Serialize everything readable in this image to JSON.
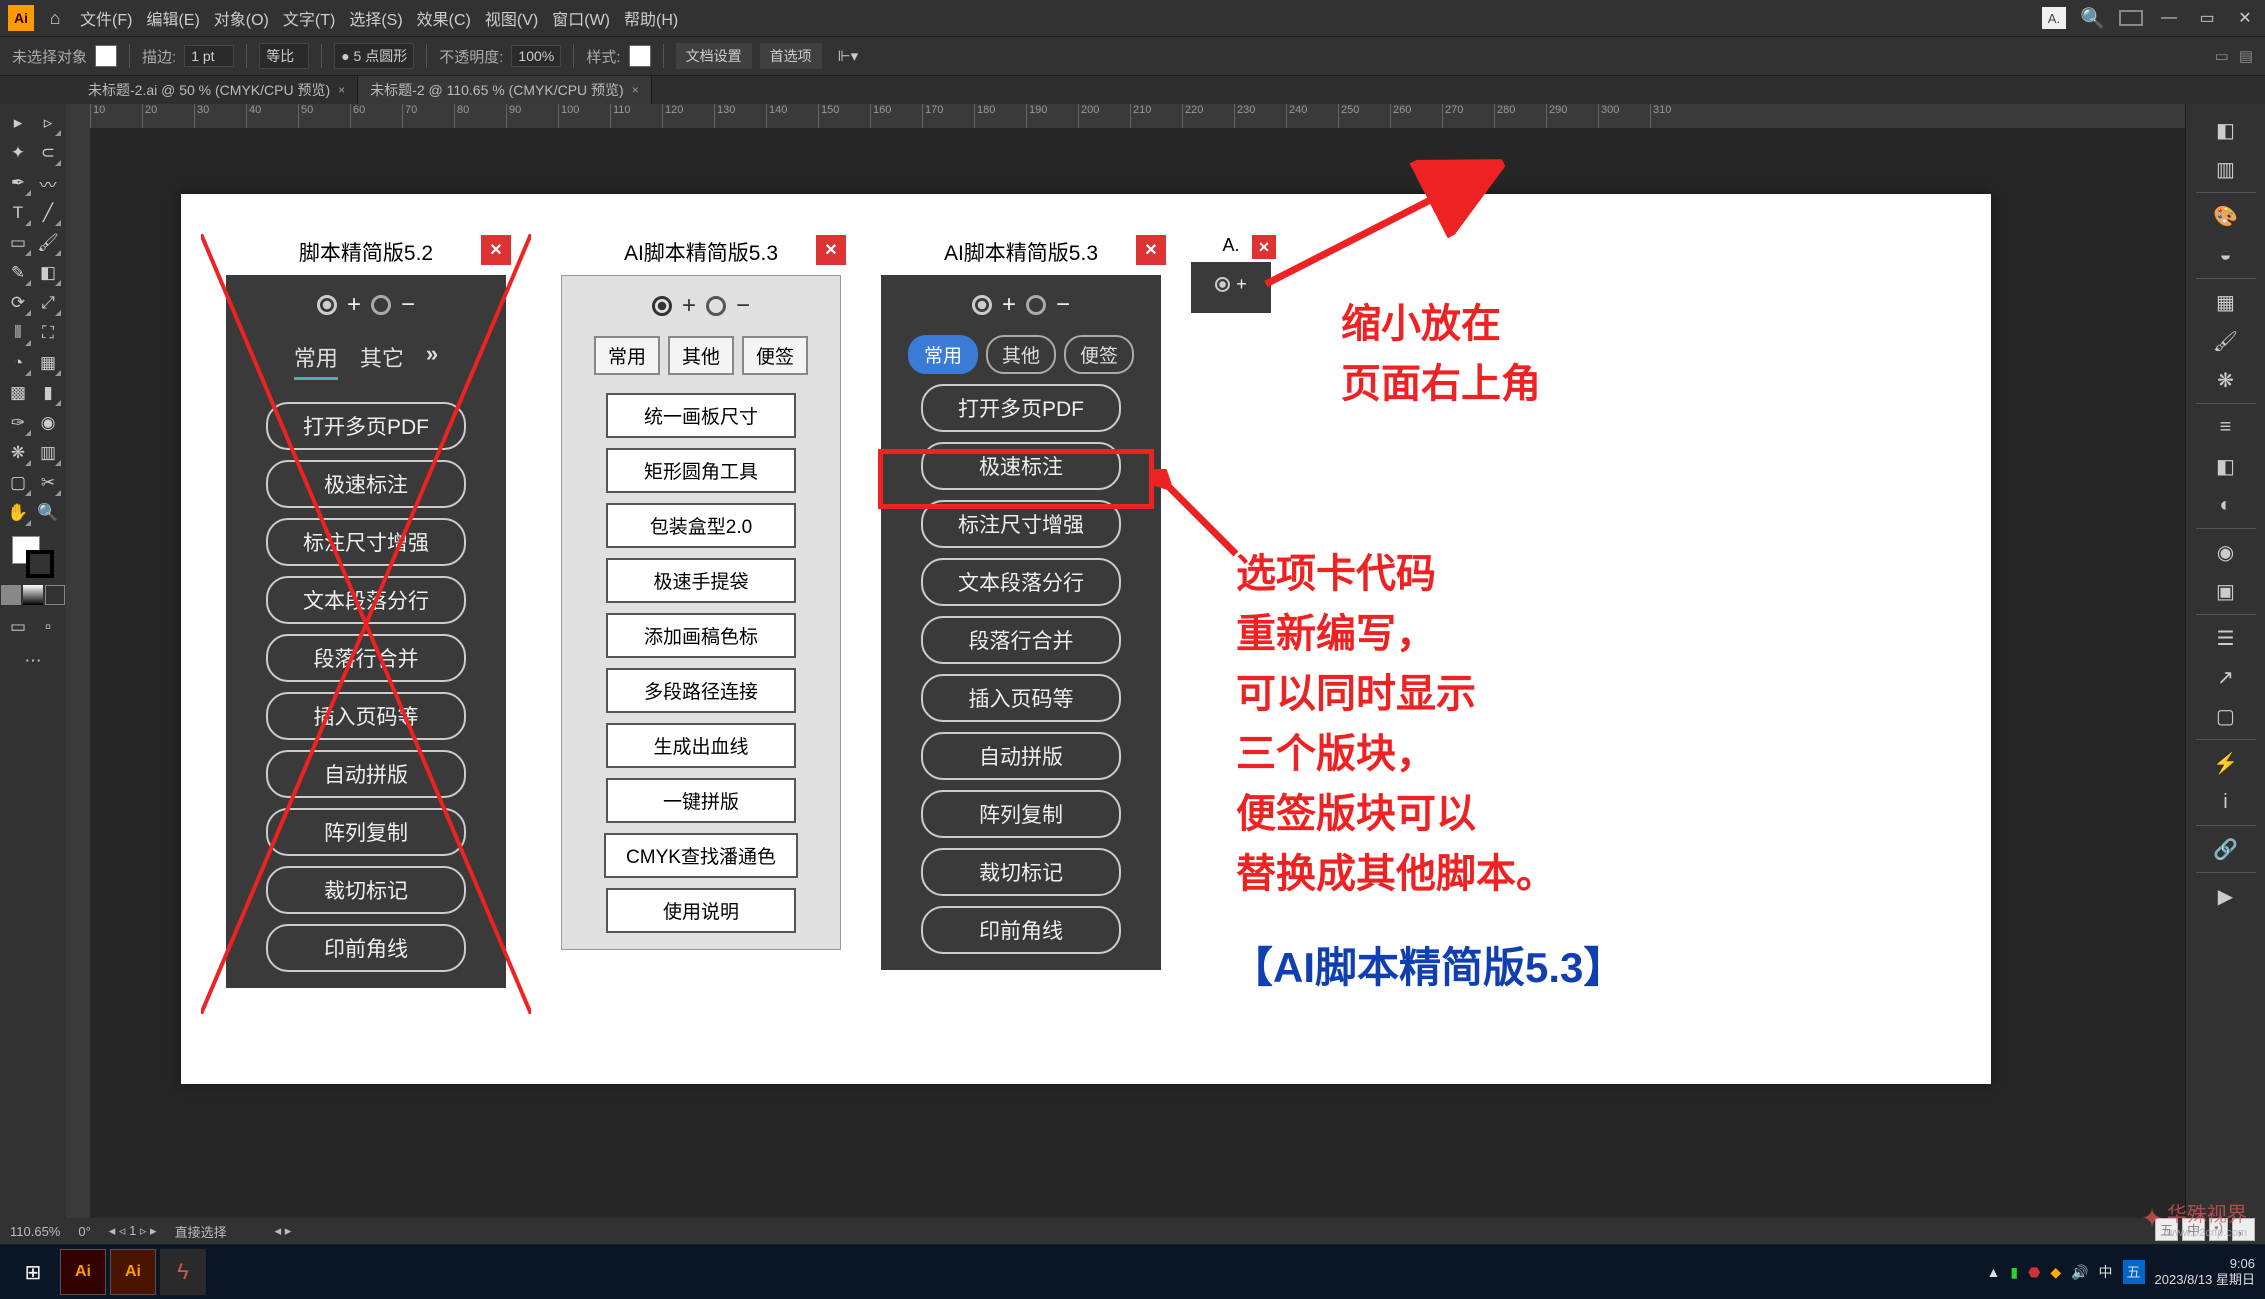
{
  "menubar": {
    "logo": "Ai",
    "items": [
      "文件(F)",
      "编辑(E)",
      "对象(O)",
      "文字(T)",
      "选择(S)",
      "效果(C)",
      "视图(V)",
      "窗口(W)",
      "帮助(H)"
    ],
    "search_small": "A."
  },
  "optbar": {
    "noselect": "未选择对象",
    "stroke_label": "描边:",
    "stroke_val": "1 pt",
    "uniform": "等比",
    "brush_label": "5 点圆形",
    "opacity_label": "不透明度:",
    "opacity_val": "100%",
    "style_label": "样式:",
    "doc_setup": "文档设置",
    "prefs": "首选项"
  },
  "tabs": [
    {
      "label": "未标题-2.ai @ 50 % (CMYK/CPU 预览)",
      "active": false
    },
    {
      "label": "未标题-2 @ 110.65 % (CMYK/CPU 预览)",
      "active": true
    }
  ],
  "panel1": {
    "title": "脚本精简版5.2",
    "tabs": [
      "常用",
      "其它"
    ],
    "buttons": [
      "打开多页PDF",
      "极速标注",
      "标注尺寸增强",
      "文本段落分行",
      "段落行合并",
      "插入页码等",
      "自动拼版",
      "阵列复制",
      "裁切标记",
      "印前角线"
    ]
  },
  "panel2": {
    "title": "AI脚本精简版5.3",
    "tabs": [
      "常用",
      "其他",
      "便签"
    ],
    "buttons": [
      "统一画板尺寸",
      "矩形圆角工具",
      "包装盒型2.0",
      "极速手提袋",
      "添加画稿色标",
      "多段路径连接",
      "生成出血线",
      "一键拼版",
      "CMYK查找潘通色",
      "使用说明"
    ]
  },
  "panel3": {
    "title": "AI脚本精简版5.3",
    "tabs": [
      "常用",
      "其他",
      "便签"
    ],
    "buttons": [
      "打开多页PDF",
      "极速标注",
      "标注尺寸增强",
      "文本段落分行",
      "段落行合并",
      "插入页码等",
      "自动拼版",
      "阵列复制",
      "裁切标记",
      "印前角线"
    ]
  },
  "panel4": {
    "title": "A."
  },
  "anno1_lines": [
    "缩小放在",
    "页面右上角"
  ],
  "anno2_lines": [
    "选项卡代码",
    "重新编写，",
    "可以同时显示",
    "三个版块，",
    "便签版块可以",
    "替换成其他脚本。"
  ],
  "anno_blue": "【AI脚本精简版5.3】",
  "ruler": [
    "10",
    "20",
    "30",
    "40",
    "50",
    "60",
    "70",
    "80",
    "90",
    "100",
    "110",
    "120",
    "130",
    "140",
    "150",
    "160",
    "170",
    "180",
    "190",
    "200",
    "210",
    "220",
    "230",
    "240",
    "250",
    "260",
    "270",
    "280",
    "290",
    "300",
    "310"
  ],
  "status": {
    "zoom": "110.65%",
    "angle": "0°",
    "artboard": "1",
    "tool": "直接选择"
  },
  "taskbar": {
    "time": "9:06",
    "date": "2023/8/13 星期日"
  },
  "watermark": "华殊视界",
  "watermark_url": "www.52cnp.com",
  "ime": [
    "五",
    "中",
    "•)",
    "，"
  ]
}
